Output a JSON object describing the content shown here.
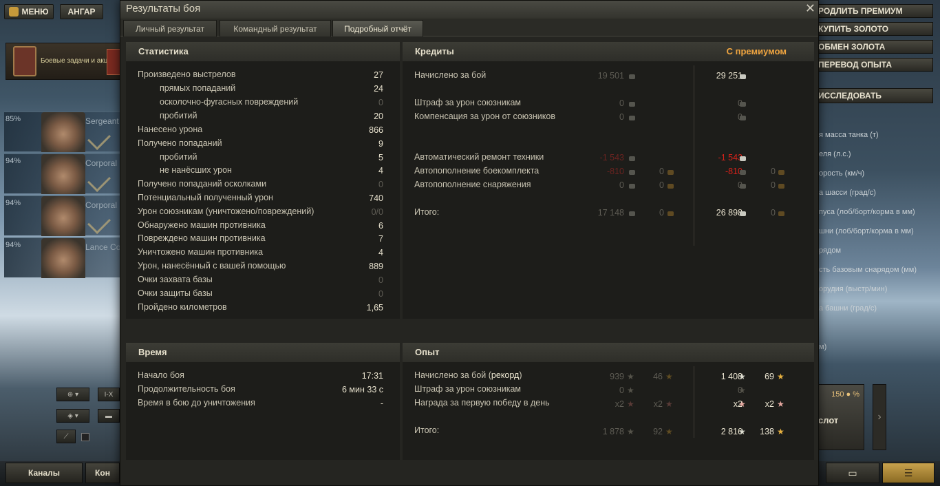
{
  "garage": {
    "menu_label": "МЕНЮ",
    "hangar_label": "АНГАР",
    "quests_label": "Боевые задачи и акции",
    "crew": [
      {
        "percent": "85%",
        "rank": "Sergeant"
      },
      {
        "percent": "94%",
        "rank": "Corporal"
      },
      {
        "percent": "94%",
        "rank": "Corporal"
      },
      {
        "percent": "94%",
        "rank": "Lance Co"
      }
    ],
    "tier_filter": "I-X",
    "channels_label": "Каналы",
    "contacts_label": "Кон",
    "right_buttons": [
      "РОДЛИТЬ ПРЕМИУМ",
      "КУПИТЬ ЗОЛОТО",
      "ОБМЕН ЗОЛОТА",
      "ПЕРЕВОД ОПЫТА"
    ],
    "research_label": "ИССЛЕДОВАТЬ",
    "tank_stats": [
      "я масса танка (т)",
      "еля (л.с.)",
      "орость (км/ч)",
      "а шасси (град/с)",
      "пуса (лоб/борт/корма в мм)",
      "шни (лоб/борт/корма в мм)",
      "рядом",
      "сть базовым снарядом (мм)",
      "орудия (выстр/мин)",
      "а башни (град/с)",
      "м)"
    ],
    "slot_price": "150",
    "slot_label": "слот"
  },
  "window": {
    "title": "Результаты боя",
    "close": "✕",
    "tabs": [
      "Личный результат",
      "Командный результат",
      "Подробный отчёт"
    ]
  },
  "stats": {
    "header": "Статистика",
    "rows": [
      {
        "label": "Произведено выстрелов",
        "value": "27"
      },
      {
        "label": "прямых попаданий",
        "value": "24"
      },
      {
        "label": "осколочно-фугасных повреждений",
        "value": "0"
      },
      {
        "label": "пробитий",
        "value": "20"
      },
      {
        "label": "Нанесено урона",
        "value": "866"
      },
      {
        "label": "Получено попаданий",
        "value": "9"
      },
      {
        "label": "пробитий",
        "value": "5"
      },
      {
        "label": "не нанёсших урон",
        "value": "4"
      },
      {
        "label": "Получено попаданий осколками",
        "value": "0"
      },
      {
        "label": "Потенциальный полученный урон",
        "value": "740"
      },
      {
        "label": "Урон союзникам (уничтожено/повреждений)",
        "value": "0/0"
      },
      {
        "label": "Обнаружено машин противника",
        "value": "6"
      },
      {
        "label": "Повреждено машин противника",
        "value": "7"
      },
      {
        "label": "Уничтожено машин противника",
        "value": "4"
      },
      {
        "label": "Урон, нанесённый с вашей помощью",
        "value": "889"
      },
      {
        "label": "Очки захвата базы",
        "value": "0"
      },
      {
        "label": "Очки защиты базы",
        "value": "0"
      },
      {
        "label": "Пройдено километров",
        "value": "1,65"
      }
    ]
  },
  "credits": {
    "header": "Кредиты",
    "premium_header": "С премиумом",
    "rows": [
      {
        "label": "Начислено за бой",
        "base": "19 501",
        "prem": "29 251"
      },
      {
        "label": "Штраф за урон союзникам",
        "base": "0",
        "prem": "0"
      },
      {
        "label": "Компенсация за урон от союзников",
        "base": "0",
        "prem": "0"
      },
      {
        "label": "Автоматический ремонт техники",
        "base": "-1 543",
        "prem": "-1 543"
      },
      {
        "label": "Автопополнение боекомплекта",
        "base": "-810",
        "base_gold": "0",
        "prem": "-810",
        "prem_gold": "0"
      },
      {
        "label": "Автопополнение снаряжения",
        "base": "0",
        "base_gold": "0",
        "prem": "0",
        "prem_gold": "0"
      },
      {
        "label": "Итого:",
        "base": "17 148",
        "base_gold": "0",
        "prem": "26 898",
        "prem_gold": "0"
      }
    ]
  },
  "time": {
    "header": "Время",
    "rows": [
      {
        "label": "Начало боя",
        "value": "17:31"
      },
      {
        "label": "Продолжительность боя",
        "value": "6 мин 33 с"
      },
      {
        "label": "Время в бою до уничтожения",
        "value": "-"
      }
    ]
  },
  "experience": {
    "header": "Опыт",
    "rows": [
      {
        "label": "Начислено за бой",
        "label_extra": "рекорд",
        "base": "939",
        "base_free": "46",
        "prem": "1 408",
        "prem_free": "69"
      },
      {
        "label": "Штраф за урон союзникам",
        "base": "0",
        "prem": "0"
      },
      {
        "label": "Награда за первую победу в день",
        "base": "x2",
        "base_free": "x2",
        "prem": "x2",
        "prem_free": "x2"
      },
      {
        "label": "Итого:",
        "base": "1 878",
        "base_free": "92",
        "prem": "2 816",
        "prem_free": "138"
      }
    ]
  },
  "colors": {
    "premium": "#f0a540",
    "negative": "#d8221a",
    "gold": "#c69a3c"
  }
}
